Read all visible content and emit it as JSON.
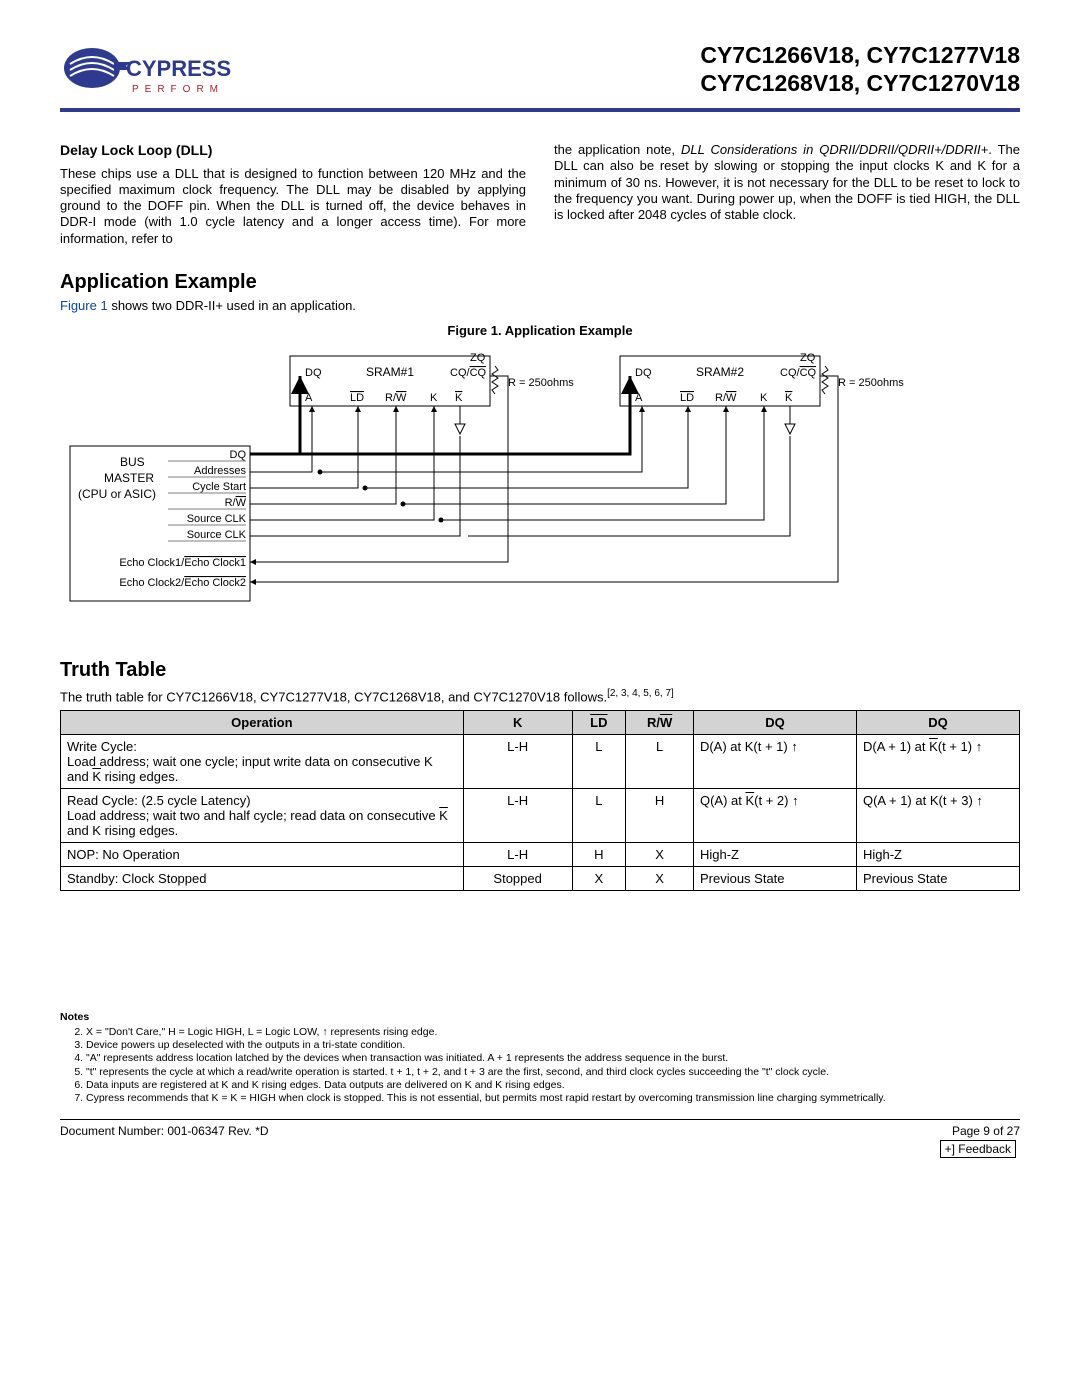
{
  "header": {
    "logo_main": "CYPRESS",
    "logo_sub": "P E R F O R M",
    "parts_line1": "CY7C1266V18, CY7C1277V18",
    "parts_line2": "CY7C1268V18, CY7C1270V18"
  },
  "dll": {
    "title": "Delay Lock Loop (DLL)",
    "col1": "These chips use a DLL that is designed to function between 120 MHz and the specified maximum clock frequency. The DLL may be disabled by applying ground to the DOFF pin. When the DLL is turned off, the device behaves in DDR-I mode (with 1.0 cycle latency and a longer access time). For more information, refer to",
    "col2_a": "the application note, ",
    "col2_ital": "DLL Considerations in QDRII/DDRII/QDRII+/DDRII+",
    "col2_b": ". The DLL can also be reset by slowing or stopping the input clocks K and K for a minimum of 30 ns. However, it is not necessary for the DLL to be reset to lock to the frequency you want. During power up, when the DOFF is tied HIGH, the DLL is locked after 2048 cycles of stable clock."
  },
  "app": {
    "title": "Application Example",
    "intro_pre": "Figure 1",
    "intro_post": " shows two DDR-II+ used in an application.",
    "fig_caption": "Figure 1. Application Example"
  },
  "diagram": {
    "sram1": "SRAM#1",
    "sram2": "SRAM#2",
    "labels": {
      "dq": "DQ",
      "a": "A",
      "ld": "LD",
      "rw": "R/W",
      "k": "K",
      "kbar": "K",
      "cq": "CQ/CQ",
      "zq": "ZQ",
      "r": "R = 250ohms"
    },
    "bus_master": {
      "title1": "BUS",
      "title2": "MASTER",
      "title3": "(CPU or ASIC)",
      "dq": "DQ",
      "addresses": "Addresses",
      "cycle_start": "Cycle Start",
      "rw": "R/W",
      "src_clk1": "Source CLK",
      "src_clk2": "Source CLK",
      "echo1": "Echo Clock1/Echo Clock1",
      "echo2": "Echo Clock2/Echo Clock2"
    }
  },
  "truth": {
    "title": "Truth Table",
    "intro": "The truth table for CY7C1266V18, CY7C1277V18, CY7C1268V18, and CY7C1270V18 follows.",
    "intro_refs": "[2, 3, 4, 5, 6, 7]",
    "headers": {
      "op": "Operation",
      "k": "K",
      "ld": "LD",
      "rw": "R/W",
      "dq1": "DQ",
      "dq2": "DQ"
    },
    "rows": [
      {
        "op_l1": "Write Cycle:",
        "op_l2a": "Load address; wait one cycle; input write data on consecutive K and ",
        "op_l2b": " rising edges.",
        "k": "L-H",
        "ld": "L",
        "rw": "L",
        "dq1": "D(A) at K(t + 1) ↑",
        "dq2_a": "D(A + 1) at ",
        "dq2_k": "K",
        "dq2_b": "(t + 1) ↑"
      },
      {
        "op_l1": "Read Cycle: (2.5 cycle Latency)",
        "op_l2a": "Load address; wait two and half cycle; read data on consecutive ",
        "op_l2b": " and K rising edges.",
        "k": "L-H",
        "ld": "L",
        "rw": "H",
        "dq1_a": "Q(A) at ",
        "dq1_k": "K",
        "dq1_b": "(t + 2) ↑",
        "dq2": "Q(A + 1) at K(t + 3) ↑"
      },
      {
        "op": "NOP: No Operation",
        "k": "L-H",
        "ld": "H",
        "rw": "X",
        "dq1": "High-Z",
        "dq2": "High-Z"
      },
      {
        "op": "Standby: Clock Stopped",
        "k": "Stopped",
        "ld": "X",
        "rw": "X",
        "dq1": "Previous State",
        "dq2": "Previous State"
      }
    ]
  },
  "notes": {
    "title": "Notes",
    "items": [
      "X = \"Don't Care,\" H = Logic HIGH, L = Logic LOW, ↑ represents rising edge.",
      "Device powers up deselected with the outputs in a tri-state condition.",
      "\"A\" represents address location latched by the devices when transaction was initiated. A + 1 represents the address sequence in the burst.",
      "\"t\" represents the cycle at which a read/write operation is started. t + 1, t + 2, and t + 3 are the first, second, and third clock cycles succeeding the \"t\" clock cycle.",
      "Data inputs are registered at K and K rising edges. Data outputs are delivered on K and K rising edges.",
      "Cypress recommends that K = K = HIGH when clock is stopped. This is not essential, but permits most rapid restart by overcoming transmission line charging symmetrically."
    ]
  },
  "footer": {
    "left": "Document Number: 001-06347  Rev. *D",
    "right": "Page 9 of 27",
    "feedback": "+] Feedback"
  }
}
